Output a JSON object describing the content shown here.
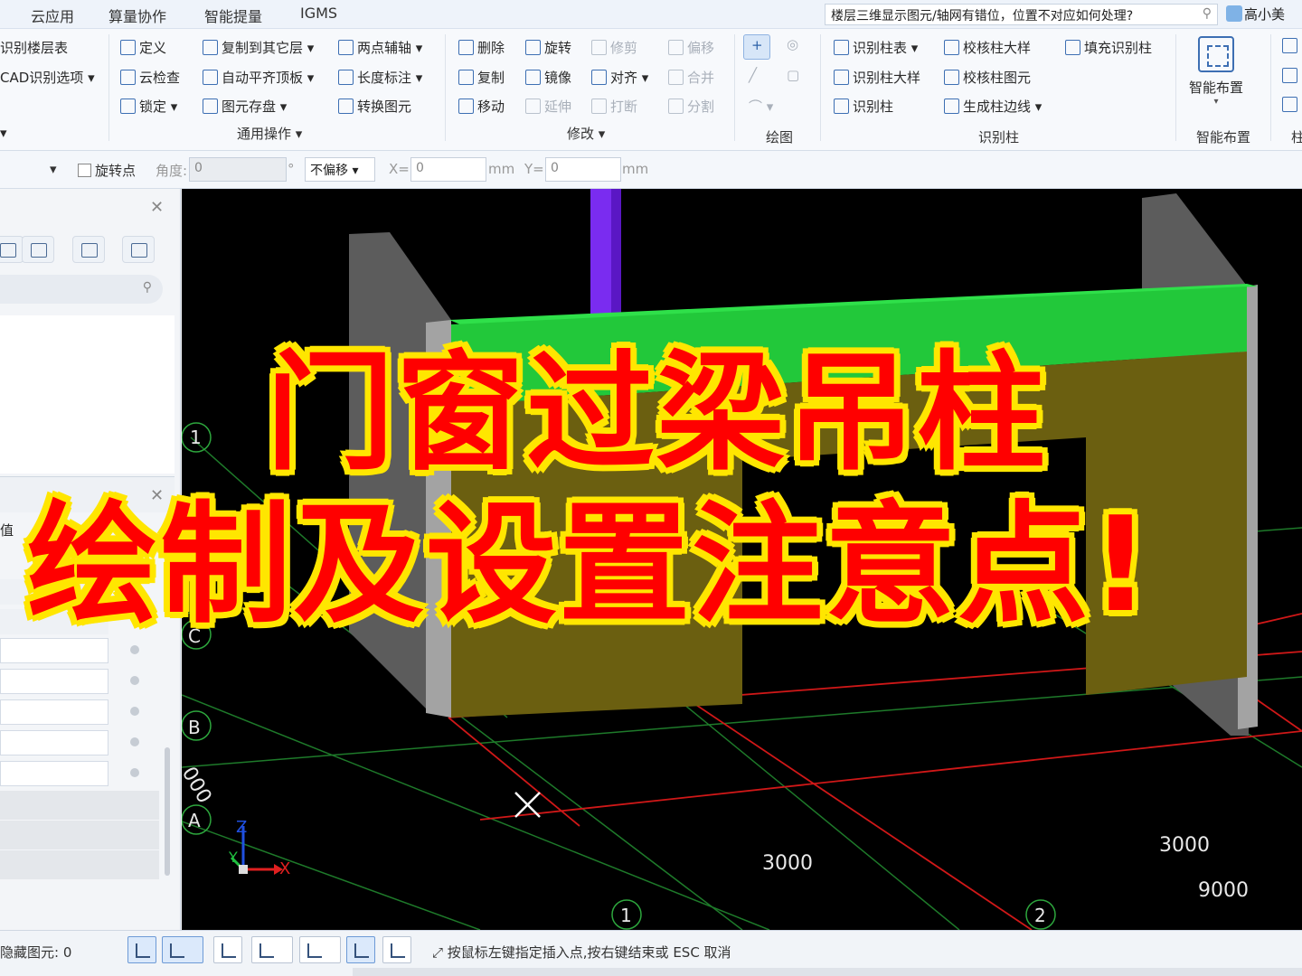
{
  "menubar": {
    "items": [
      "云应用",
      "算量协作",
      "智能提量",
      "IGMS"
    ],
    "help_search": "楼层三维显示图元/轴网有错位，位置不对应如何处理?",
    "user_name": "高小美"
  },
  "ribbon": {
    "col1": [
      "识别楼层表",
      "CAD识别选项"
    ],
    "general": {
      "label": "通用操作",
      "items": [
        "定义",
        "云检查",
        "锁定",
        "复制到其它层",
        "自动平齐顶板",
        "图元存盘",
        "两点辅轴",
        "长度标注",
        "转换图元"
      ]
    },
    "modify": {
      "label": "修改",
      "items": [
        "删除",
        "复制",
        "移动",
        "旋转",
        "镜像",
        "延伸",
        "修剪",
        "对齐",
        "打断",
        "偏移",
        "合并",
        "分割"
      ]
    },
    "draw": {
      "label": "绘图"
    },
    "recognize_column": {
      "label": "识别柱",
      "items": [
        "识别柱表",
        "识别柱大样",
        "识别柱",
        "校核柱大样",
        "校核柱图元",
        "生成柱边线",
        "填充识别柱"
      ]
    },
    "smart_layout": {
      "button": "智能布置",
      "label": "智能布置"
    },
    "last_label": "柱"
  },
  "proptool": {
    "rotate_point": "旋转点",
    "angle_label": "角度:",
    "angle_value": "0",
    "degree": "°",
    "offset_mode": "不偏移",
    "x_label": "X=",
    "x_value": "0",
    "y_label": "Y=",
    "y_value": "0",
    "unit": "mm"
  },
  "leftpanel": {
    "value_header": "值"
  },
  "viewport": {
    "axis_labels": [
      "1",
      "C",
      "B",
      "A",
      "1",
      "2"
    ],
    "dims": [
      "3000",
      "3000",
      "9000",
      "000"
    ],
    "triad": {
      "x": "X",
      "y": "Y",
      "z": "Z"
    },
    "colors": {
      "beam": "#22c83a",
      "column_purple": "#7a2cf0",
      "wall_door": "#6b5f10",
      "wall_gray": "#7a7a7a",
      "grid_red": "#d01818",
      "grid_green": "#1e7a2a"
    }
  },
  "overlay": {
    "line1": "门窗过梁吊柱",
    "line2": "绘制及设置注意点!"
  },
  "statusbar": {
    "hidden_elements": "隐藏图元: 0",
    "hint": "按鼠标左键指定插入点,按右键结束或 ESC 取消"
  }
}
